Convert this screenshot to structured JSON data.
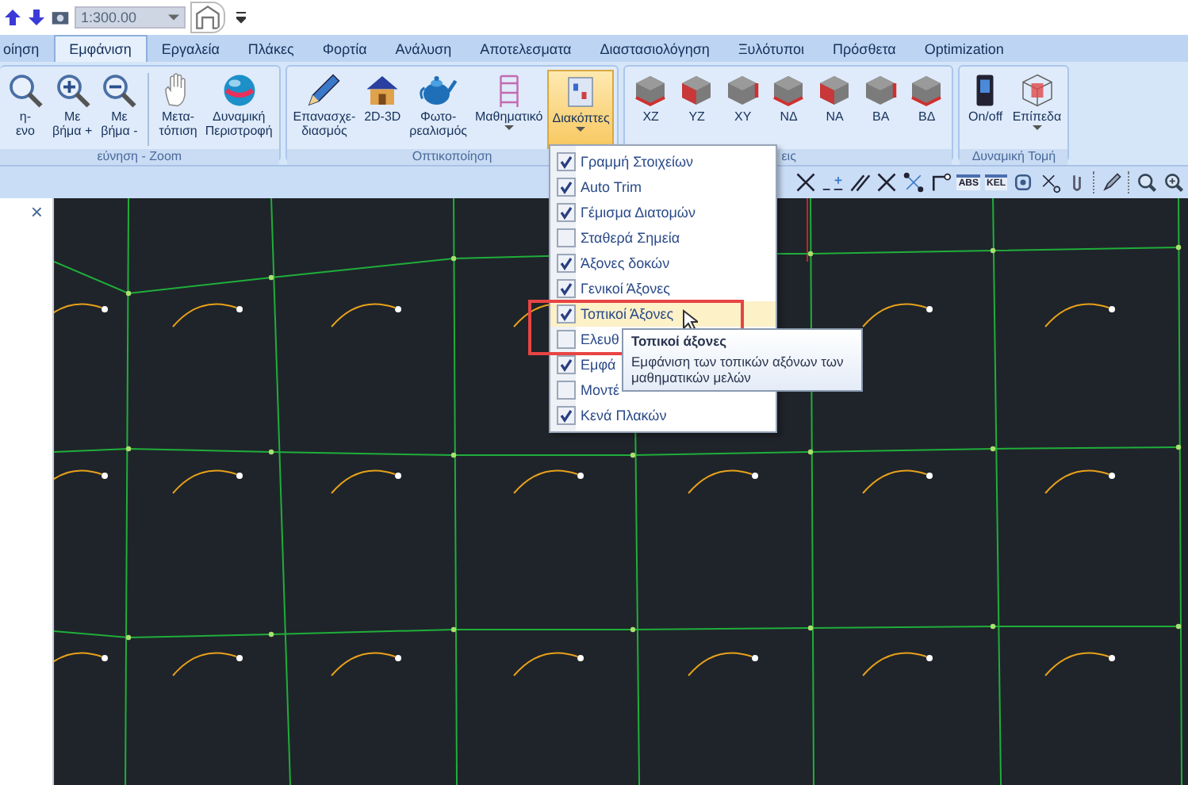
{
  "quick_access": {
    "scale_value": "1:300.00"
  },
  "tabs": [
    {
      "label": "οίηση",
      "selected": false
    },
    {
      "label": "Εμφάνιση",
      "selected": true
    },
    {
      "label": "Εργαλεία",
      "selected": false
    },
    {
      "label": "Πλάκες",
      "selected": false
    },
    {
      "label": "Φορτία",
      "selected": false
    },
    {
      "label": "Ανάλυση",
      "selected": false
    },
    {
      "label": "Αποτελεσματα",
      "selected": false
    },
    {
      "label": "Διαστασιολόγηση",
      "selected": false
    },
    {
      "label": "Ξυλότυποι",
      "selected": false
    },
    {
      "label": "Πρόσθετα",
      "selected": false
    },
    {
      "label": "Optimization",
      "selected": false
    }
  ],
  "ribbon_groups": [
    {
      "label": "εύνηση - Zoom",
      "buttons": [
        {
          "kind": "magnifier",
          "lines": [
            "η-",
            "ενο"
          ],
          "pressed": false,
          "dropdown": false
        },
        {
          "kind": "zoom-in",
          "lines": [
            "Με",
            "βήμα +"
          ],
          "pressed": false,
          "dropdown": false
        },
        {
          "kind": "zoom-out",
          "lines": [
            "Με",
            "βήμα -"
          ],
          "pressed": false,
          "dropdown": false
        },
        {
          "kind": "separator"
        },
        {
          "kind": "hand",
          "lines": [
            "Μετα-",
            "τόπιση"
          ],
          "pressed": false,
          "dropdown": false
        },
        {
          "kind": "globe",
          "lines": [
            "Δυναμική",
            "Περιστροφή"
          ],
          "pressed": false,
          "dropdown": false
        }
      ]
    },
    {
      "label": "Οπτικοποίηση",
      "buttons": [
        {
          "kind": "pencil",
          "lines": [
            "Επανασχε-",
            "διασμός"
          ],
          "pressed": false,
          "dropdown": false
        },
        {
          "kind": "house",
          "lines": [
            "2D-3D"
          ],
          "pressed": false,
          "dropdown": false
        },
        {
          "kind": "teapot",
          "lines": [
            "Φωτο-",
            "ρεαλισμός"
          ],
          "pressed": false,
          "dropdown": false
        },
        {
          "kind": "frame",
          "lines": [
            "Μαθηματικό"
          ],
          "pressed": false,
          "dropdown": true
        },
        {
          "kind": "switches",
          "lines": [
            "Διακόπτες"
          ],
          "pressed": true,
          "dropdown": true
        }
      ]
    },
    {
      "label": "εις",
      "buttons": [
        {
          "kind": "cube",
          "lines": [
            "XZ"
          ],
          "pressed": false,
          "dropdown": false
        },
        {
          "kind": "cube",
          "lines": [
            "YZ"
          ],
          "pressed": false,
          "dropdown": false
        },
        {
          "kind": "cube",
          "lines": [
            "XY"
          ],
          "pressed": false,
          "dropdown": false
        },
        {
          "kind": "cube",
          "lines": [
            "ΝΔ"
          ],
          "pressed": false,
          "dropdown": false
        },
        {
          "kind": "cube",
          "lines": [
            "ΝΑ"
          ],
          "pressed": false,
          "dropdown": false
        },
        {
          "kind": "cube",
          "lines": [
            "ΒΑ"
          ],
          "pressed": false,
          "dropdown": false
        },
        {
          "kind": "cube",
          "lines": [
            "ΒΔ"
          ],
          "pressed": false,
          "dropdown": false
        }
      ]
    },
    {
      "label": "Δυναμική Τομή",
      "buttons": [
        {
          "kind": "switch",
          "lines": [
            "On/off"
          ],
          "pressed": false,
          "dropdown": false
        },
        {
          "kind": "wire-cube",
          "lines": [
            "Επίπεδα"
          ],
          "pressed": false,
          "dropdown": true
        }
      ]
    }
  ],
  "toolbar": [
    {
      "kind": "cross"
    },
    {
      "kind": "dash"
    },
    {
      "kind": "lines"
    },
    {
      "kind": "cross"
    },
    {
      "kind": "nodes"
    },
    {
      "kind": "corner"
    },
    {
      "kind": "text",
      "label": "ABS"
    },
    {
      "kind": "text",
      "label": "KEL"
    },
    {
      "kind": "target"
    },
    {
      "kind": "x-small"
    },
    {
      "kind": "clip"
    },
    {
      "kind": "sep"
    },
    {
      "kind": "pen"
    },
    {
      "kind": "sep"
    },
    {
      "kind": "magnifier"
    },
    {
      "kind": "zoom-in"
    }
  ],
  "side_panel": {
    "close": "×"
  },
  "menu": [
    {
      "label": "Γραμμή Στοιχείων",
      "checked": true,
      "hovered": false
    },
    {
      "label": "Auto Trim",
      "checked": true,
      "hovered": false
    },
    {
      "label": "Γέμισμα Διατομών",
      "checked": true,
      "hovered": false
    },
    {
      "label": "Σταθερά Σημεία",
      "checked": false,
      "hovered": false
    },
    {
      "label": "Άξονες δοκών",
      "checked": true,
      "hovered": false
    },
    {
      "label": "Γενικοί Άξονες",
      "checked": true,
      "hovered": false
    },
    {
      "label": "Τοπικοί Άξονες",
      "checked": true,
      "hovered": true
    },
    {
      "label": "Ελευθ",
      "checked": false,
      "hovered": false
    },
    {
      "label": "Εμφά",
      "checked": true,
      "hovered": false
    },
    {
      "label": "Μοντέ",
      "checked": false,
      "hovered": false
    },
    {
      "label": "Κενά Πλακών",
      "checked": true,
      "hovered": false
    }
  ],
  "tooltip": {
    "title": "Τοπικοί άξονες",
    "text": "Εμφάνιση των τοπικών  αξόνων των μαθηματικών  μελών"
  }
}
